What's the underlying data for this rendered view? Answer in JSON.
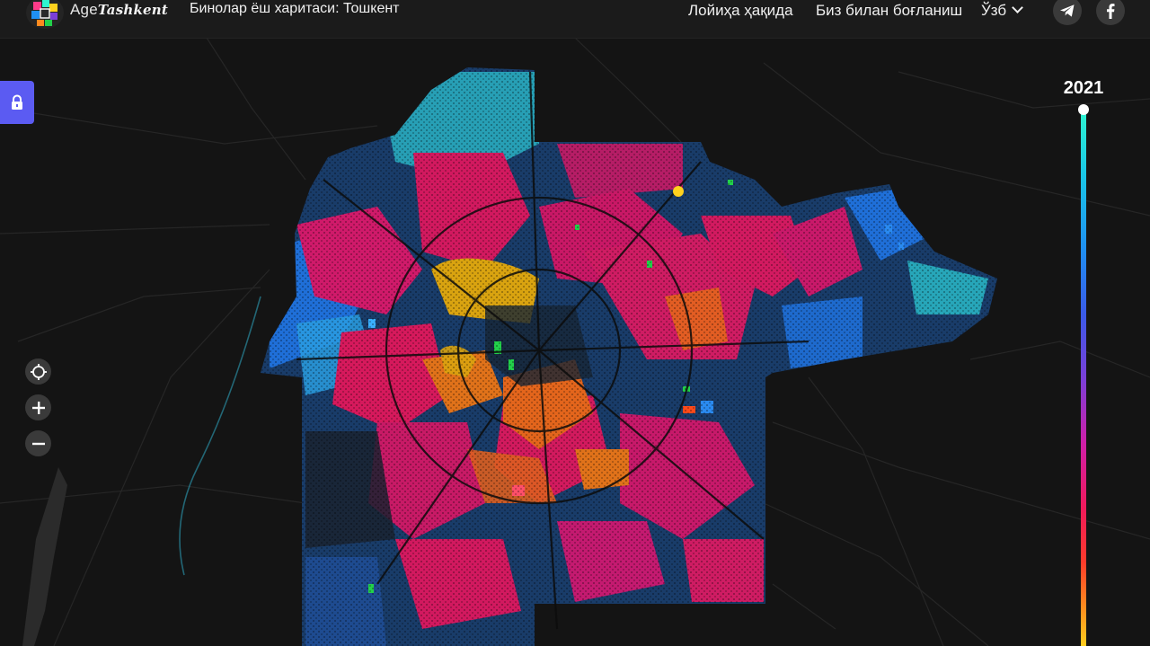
{
  "header": {
    "logo_prefix": "Age",
    "logo_brand": "Tashkent",
    "title": "Бинолар ёш харитаси:  Тошкент",
    "nav": {
      "about": "Лойиҳа ҳақида",
      "contact": "Биз билан боғланиш",
      "language": "Ўзб"
    },
    "social": [
      "telegram-icon",
      "facebook-icon"
    ]
  },
  "controls": {
    "lock": "lock-icon",
    "locate": "crosshair-icon",
    "zoom_in": "plus-icon",
    "zoom_out": "minus-icon"
  },
  "timeline": {
    "year": "2021",
    "gradient": [
      "#2ef5d0",
      "#1f8ff2",
      "#7b3fd8",
      "#d01ea8",
      "#f01a5a",
      "#ff8a1e",
      "#ffd21e"
    ]
  },
  "map": {
    "colors": {
      "background": "#141414",
      "magenta": "#d2195f",
      "blue": "#1f6fd8",
      "cyan": "#2ab8c8",
      "orange": "#e3651c",
      "gold": "#d9a310",
      "green": "#22d04a",
      "dark": "#1c2630"
    }
  }
}
